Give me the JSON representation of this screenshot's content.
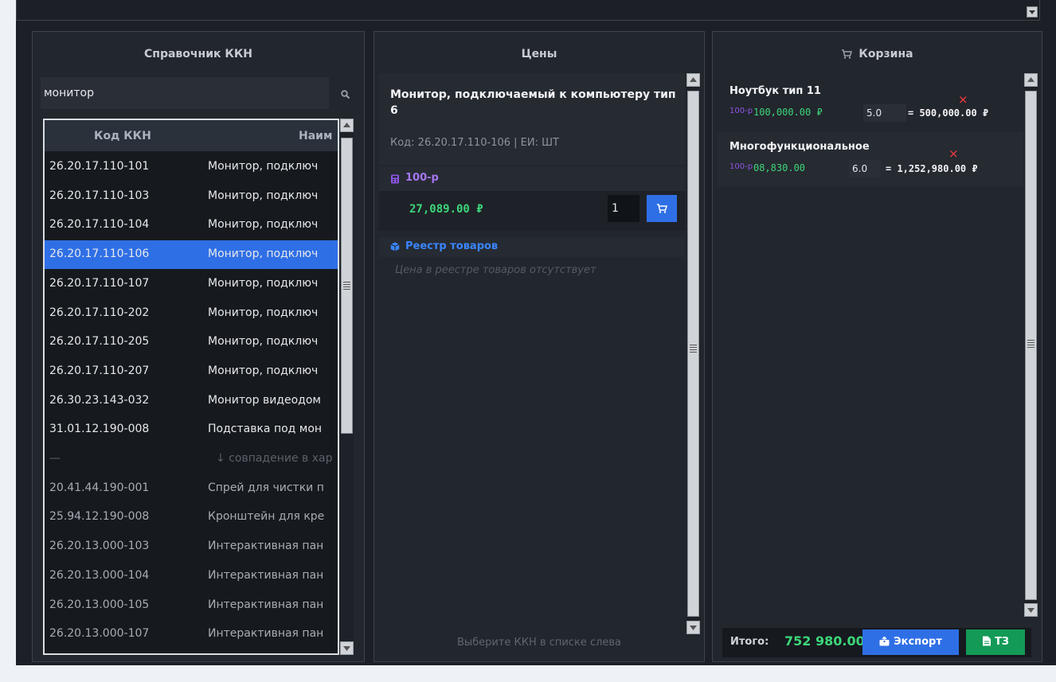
{
  "left": {
    "title": "Справочник ККН",
    "search_value": "монитор",
    "search_icon": "search-icon",
    "columns": [
      "Код ККН",
      "Наим"
    ],
    "rows": [
      {
        "code": "26.20.17.110-101",
        "name": "Монитор, подключ"
      },
      {
        "code": "26.20.17.110-103",
        "name": "Монитор, подключ"
      },
      {
        "code": "26.20.17.110-104",
        "name": "Монитор, подключ"
      },
      {
        "code": "26.20.17.110-106",
        "name": "Монитор, подключ"
      },
      {
        "code": "26.20.17.110-107",
        "name": "Монитор, подключ"
      },
      {
        "code": "26.20.17.110-202",
        "name": "Монитор, подключ"
      },
      {
        "code": "26.20.17.110-205",
        "name": "Монитор, подключ"
      },
      {
        "code": "26.20.17.110-207",
        "name": "Монитор, подключ"
      },
      {
        "code": "26.30.23.143-032",
        "name": "Монитор видеодом"
      },
      {
        "code": "31.01.12.190-008",
        "name": "Подставка под мон"
      },
      {
        "code": "—",
        "name": "↓ совпадение в хар"
      },
      {
        "code": "20.41.44.190-001",
        "name": "Спрей для чистки п"
      },
      {
        "code": "25.94.12.190-008",
        "name": "Кронштейн для кре"
      },
      {
        "code": "26.20.13.000-103",
        "name": "Интерактивная пан"
      },
      {
        "code": "26.20.13.000-104",
        "name": "Интерактивная пан"
      },
      {
        "code": "26.20.13.000-105",
        "name": "Интерактивная пан"
      },
      {
        "code": "26.20.13.000-107",
        "name": "Интерактивная пан"
      }
    ],
    "selected_code": "26.20.17.110-106"
  },
  "middle": {
    "title": "Цены",
    "product_title": "Монитор, подключаемый к компьютеру тип 6",
    "product_code": "Код: 26.20.17.110-106  |  ЕИ: ШТ",
    "price_source": "100-р",
    "price": "27,089.00 ₽",
    "quantity": "1",
    "registry_title": "Реестр товаров",
    "registry_empty": "Цена в реестре товаров отсутствует",
    "footer_hint": "Выберите ККН в списке слева"
  },
  "right": {
    "title": "Корзина",
    "items": [
      {
        "name": "Ноутбук тип 11",
        "source": "100-р",
        "price": "100,000.00 ₽",
        "qty": "5.0",
        "total": "= 500,000.00 ₽"
      },
      {
        "name": "Многофункциональное",
        "source": "100-р",
        "price": "08,830.00",
        "qty": "6.0",
        "total": "= 1,252,980.00 ₽"
      }
    ],
    "remove_symbol": "×",
    "total_label": "Итого:",
    "total_value": "752 980.00",
    "export_label": "Экспорт",
    "tz_label": "ТЗ"
  },
  "colors": {
    "accent": "#2f6fe6",
    "price_green": "#3dd67a",
    "source_purple": "#8f54e6",
    "remove_red": "#ff3c3c",
    "tz_green": "#139a57"
  }
}
